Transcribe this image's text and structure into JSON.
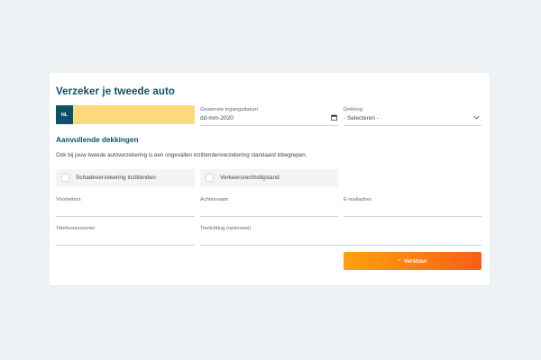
{
  "form": {
    "title": "Verzeker je tweede auto",
    "plate": {
      "country_code": "NL",
      "value": ""
    },
    "start_date": {
      "label": "Gewenste ingangsdatum",
      "value": "dd-mm-2020"
    },
    "coverage": {
      "label": "Dekking",
      "selected": "- Selecteren -"
    },
    "extra": {
      "title": "Aanvullende dekkingen",
      "intro": "Ook bij jouw tweede autoverzekering is een ongevallen inzittendenverzekering standaard inbegrepen.",
      "options": [
        {
          "label": "Schadeverzekering inzittenden",
          "checked": false
        },
        {
          "label": "Verkeersrechtsbijstand",
          "checked": false
        }
      ]
    },
    "fields": {
      "initials": {
        "label": "Voorletters",
        "value": ""
      },
      "last_name": {
        "label": "Achternaam",
        "value": ""
      },
      "email": {
        "label": "E-mailadres",
        "value": ""
      },
      "phone": {
        "label": "Telefoonnummer",
        "value": ""
      },
      "comment": {
        "label": "Toelichting (optioneel)",
        "value": ""
      }
    },
    "submit": {
      "arrow": "›",
      "label": "Verstuur"
    }
  },
  "icons": {
    "date": "calendar-icon",
    "select": "chevron-down-icon",
    "submit": "chevron-right-icon"
  },
  "colors": {
    "accent": "#0d5168",
    "plate": "#fbd97c",
    "button_start": "#fda20d",
    "button_end": "#f95f16",
    "background": "#eef2f4"
  }
}
